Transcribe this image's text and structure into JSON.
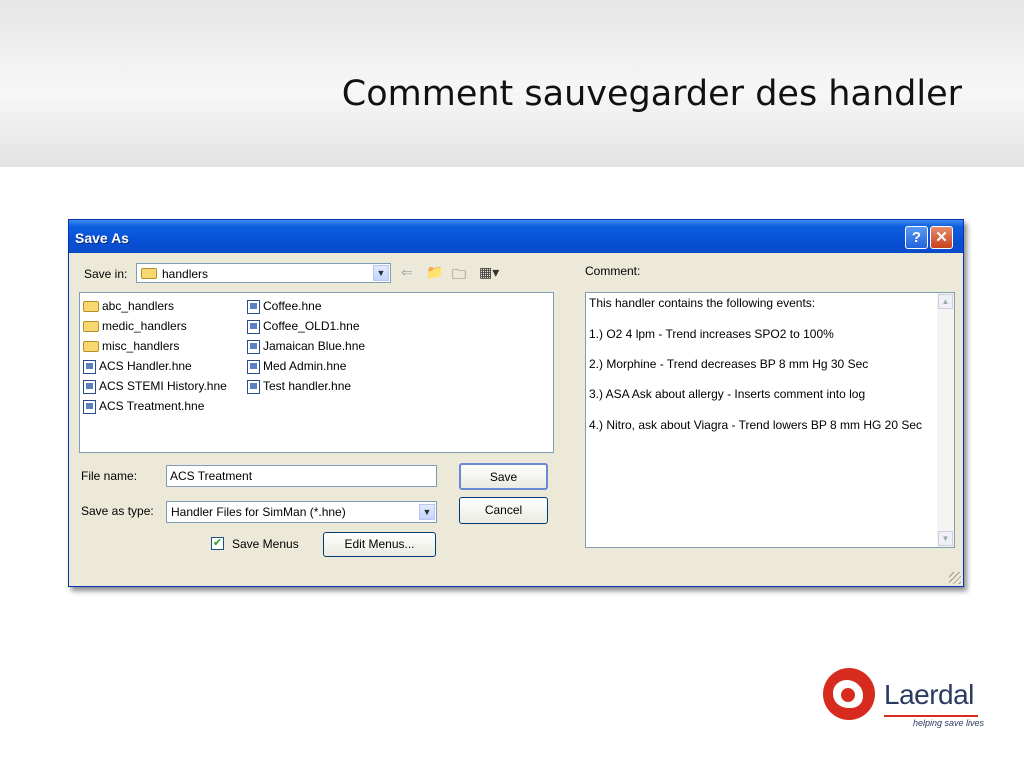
{
  "slide": {
    "title": "Comment sauvegarder des handler"
  },
  "dialog": {
    "title": "Save As",
    "help_glyph": "?",
    "close_glyph": "✕",
    "save_in_label": "Save in:",
    "save_in_value": "handlers",
    "file_list": {
      "column1": [
        {
          "name": "abc_handlers",
          "icon": "folder-icon"
        },
        {
          "name": "medic_handlers",
          "icon": "folder-icon"
        },
        {
          "name": "misc_handlers",
          "icon": "folder-icon"
        },
        {
          "name": "ACS Handler.hne",
          "icon": "hne-file-icon"
        },
        {
          "name": "ACS STEMI History.hne",
          "icon": "hne-file-icon"
        },
        {
          "name": "ACS Treatment.hne",
          "icon": "hne-file-icon"
        }
      ],
      "column2": [
        {
          "name": "Coffee.hne",
          "icon": "hne-file-icon"
        },
        {
          "name": "Coffee_OLD1.hne",
          "icon": "hne-file-icon"
        },
        {
          "name": "Jamaican Blue.hne",
          "icon": "hne-file-icon"
        },
        {
          "name": "Med Admin.hne",
          "icon": "hne-file-icon"
        },
        {
          "name": "Test handler.hne",
          "icon": "hne-file-icon"
        }
      ]
    },
    "file_name_label": "File name:",
    "file_name_value": "ACS Treatment",
    "save_as_type_label": "Save as type:",
    "save_as_type_value": "Handler Files for SimMan (*.hne)",
    "save_button": "Save",
    "cancel_button": "Cancel",
    "save_menus_label": "Save Menus",
    "save_menus_checked": true,
    "edit_menus_button": "Edit Menus...",
    "comment_label": "Comment:",
    "comment_lines": [
      "This handler contains the following events:",
      "1.) O2 4 lpm - Trend increases SPO2 to 100%",
      "2.) Morphine - Trend decreases BP 8 mm Hg 30 Sec",
      "3.) ASA Ask about allergy - Inserts comment into log",
      "4.) Nitro, ask about Viagra - Trend lowers BP 8 mm HG 20 Sec"
    ],
    "toolbar_icons": [
      "back-arrow-icon",
      "up-folder-icon",
      "new-folder-icon",
      "view-menu-icon"
    ]
  },
  "logo": {
    "name": "Laerdal",
    "tagline": "helping save lives",
    "accent": "#d62b1e"
  }
}
